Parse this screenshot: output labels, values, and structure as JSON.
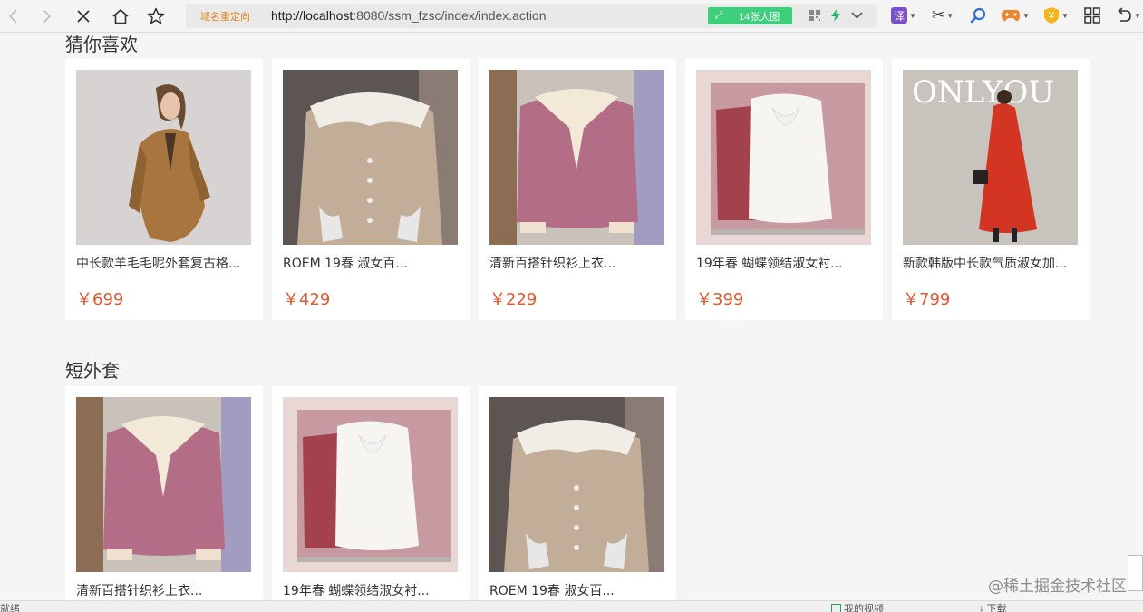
{
  "browser": {
    "redirect_label": "域名重定向",
    "url_host": "http://localhost",
    "url_rest": ":8080/ssm_fzsc/index/index.action",
    "big_pic_label": "14张大图",
    "translate_label": "译"
  },
  "sections": [
    {
      "title": "猜你喜欢",
      "products": [
        {
          "name": "中长款羊毛毛呢外套复古格...",
          "price": "￥699",
          "image": "camel-coat"
        },
        {
          "name": "ROEM 19春 淑女百...",
          "price": "￥429",
          "image": "beige-cardigan-lace-collar"
        },
        {
          "name": "清新百搭针织衫上衣...",
          "price": "￥229",
          "image": "pink-knit-cream-collar"
        },
        {
          "name": "19年春 蝴蝶领结淑女衬...",
          "price": "￥399",
          "image": "white-bow-blouse"
        },
        {
          "name": "新款韩版中长款气质淑女加...",
          "price": "￥799",
          "image": "red-long-coat"
        }
      ]
    },
    {
      "title": "短外套",
      "products": [
        {
          "name": "清新百搭针织衫上衣...",
          "price": "",
          "image": "pink-knit-cream-collar"
        },
        {
          "name": "19年春 蝴蝶领结淑女衬...",
          "price": "",
          "image": "white-bow-blouse"
        },
        {
          "name": "ROEM 19春 淑女百...",
          "price": "",
          "image": "beige-cardigan-lace-collar"
        }
      ]
    }
  ],
  "statusbar": {
    "left_text": "就绪",
    "video_label": "我的视频",
    "download_label": "下载"
  },
  "watermark": "@稀土掘金技术社区",
  "colors": {
    "price": "#e4572e",
    "big_pic_bg": "#3ecf7c",
    "redirect": "#e8801d"
  }
}
